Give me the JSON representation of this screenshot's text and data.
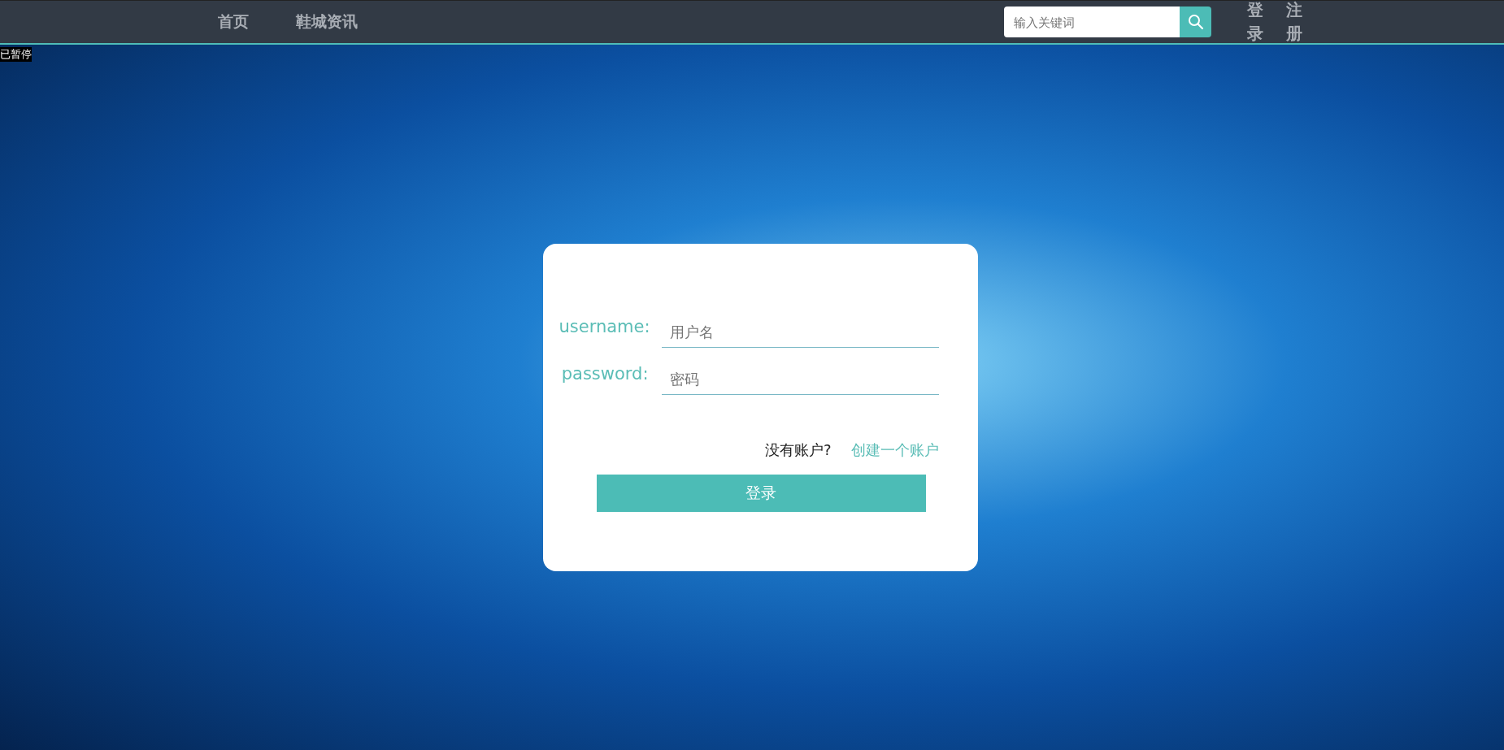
{
  "nav": {
    "links": [
      "首页",
      "鞋城资讯"
    ],
    "search": {
      "placeholder": "输入关键词"
    },
    "auth_links": [
      "登录",
      "注册"
    ]
  },
  "paused_label": "已暂停",
  "login": {
    "fields": [
      {
        "label": "username:",
        "placeholder": "用户名"
      },
      {
        "label": "password:",
        "placeholder": "密码"
      }
    ],
    "prompt": "没有账户?",
    "create_link": "创建一个账户",
    "submit": "登录"
  }
}
